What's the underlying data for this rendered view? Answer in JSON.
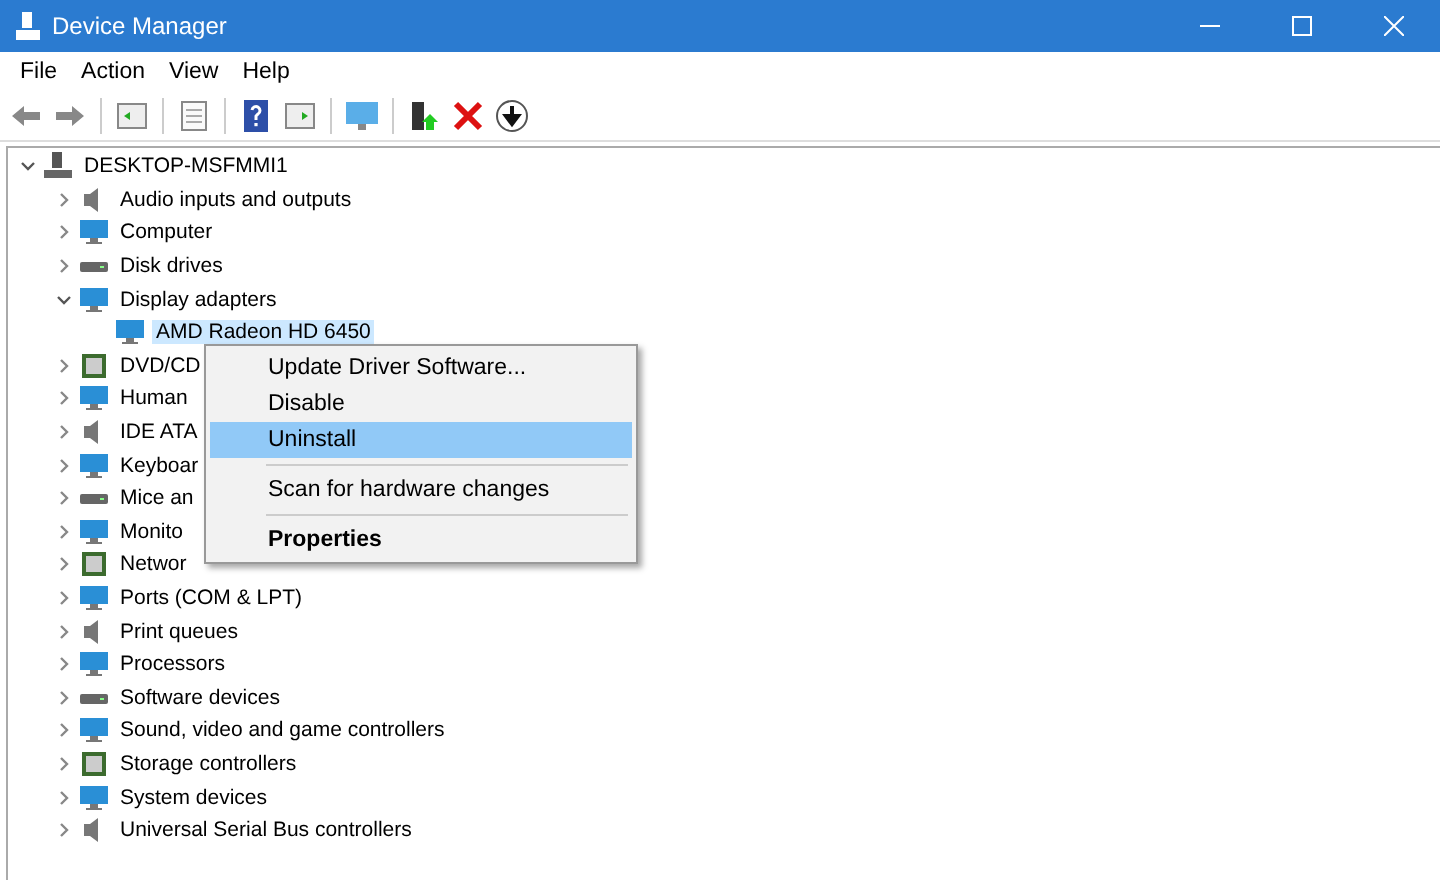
{
  "window": {
    "title": "Device Manager"
  },
  "menu_bar": [
    "File",
    "Action",
    "View",
    "Help"
  ],
  "tree": {
    "label": "DESKTOP-MSFMMI1",
    "expanded": true,
    "children": [
      {
        "label": "Audio inputs and outputs",
        "expanded": false,
        "selected": false
      },
      {
        "label": "Computer",
        "expanded": false,
        "selected": false
      },
      {
        "label": "Disk drives",
        "expanded": false,
        "selected": false
      },
      {
        "label": "Display adapters",
        "expanded": true,
        "selected": false,
        "children": [
          {
            "label": "AMD Radeon HD 6450",
            "selected": true
          }
        ]
      },
      {
        "label": "DVD/CD",
        "expanded": false,
        "selected": false
      },
      {
        "label": "Human",
        "expanded": false,
        "selected": false
      },
      {
        "label": "IDE ATA",
        "expanded": false,
        "selected": false
      },
      {
        "label": "Keyboar",
        "expanded": false,
        "selected": false
      },
      {
        "label": "Mice an",
        "expanded": false,
        "selected": false
      },
      {
        "label": "Monito",
        "expanded": false,
        "selected": false
      },
      {
        "label": "Networ",
        "expanded": false,
        "selected": false
      },
      {
        "label": "Ports (COM & LPT)",
        "expanded": false,
        "selected": false
      },
      {
        "label": "Print queues",
        "expanded": false,
        "selected": false
      },
      {
        "label": "Processors",
        "expanded": false,
        "selected": false
      },
      {
        "label": "Software devices",
        "expanded": false,
        "selected": false
      },
      {
        "label": "Sound, video and game controllers",
        "expanded": false,
        "selected": false
      },
      {
        "label": "Storage controllers",
        "expanded": false,
        "selected": false
      },
      {
        "label": "System devices",
        "expanded": false,
        "selected": false
      },
      {
        "label": "Universal Serial Bus controllers",
        "expanded": false,
        "selected": false
      }
    ]
  },
  "context_menu": [
    {
      "kind": "item",
      "label": "Update Driver Software...",
      "selected": false,
      "default": false
    },
    {
      "kind": "item",
      "label": "Disable",
      "selected": false,
      "default": false
    },
    {
      "kind": "item",
      "label": "Uninstall",
      "selected": true,
      "default": false
    },
    {
      "kind": "separator"
    },
    {
      "kind": "item",
      "label": "Scan for hardware changes",
      "selected": false,
      "default": false
    },
    {
      "kind": "separator"
    },
    {
      "kind": "item",
      "label": "Properties",
      "selected": false,
      "default": true
    }
  ]
}
